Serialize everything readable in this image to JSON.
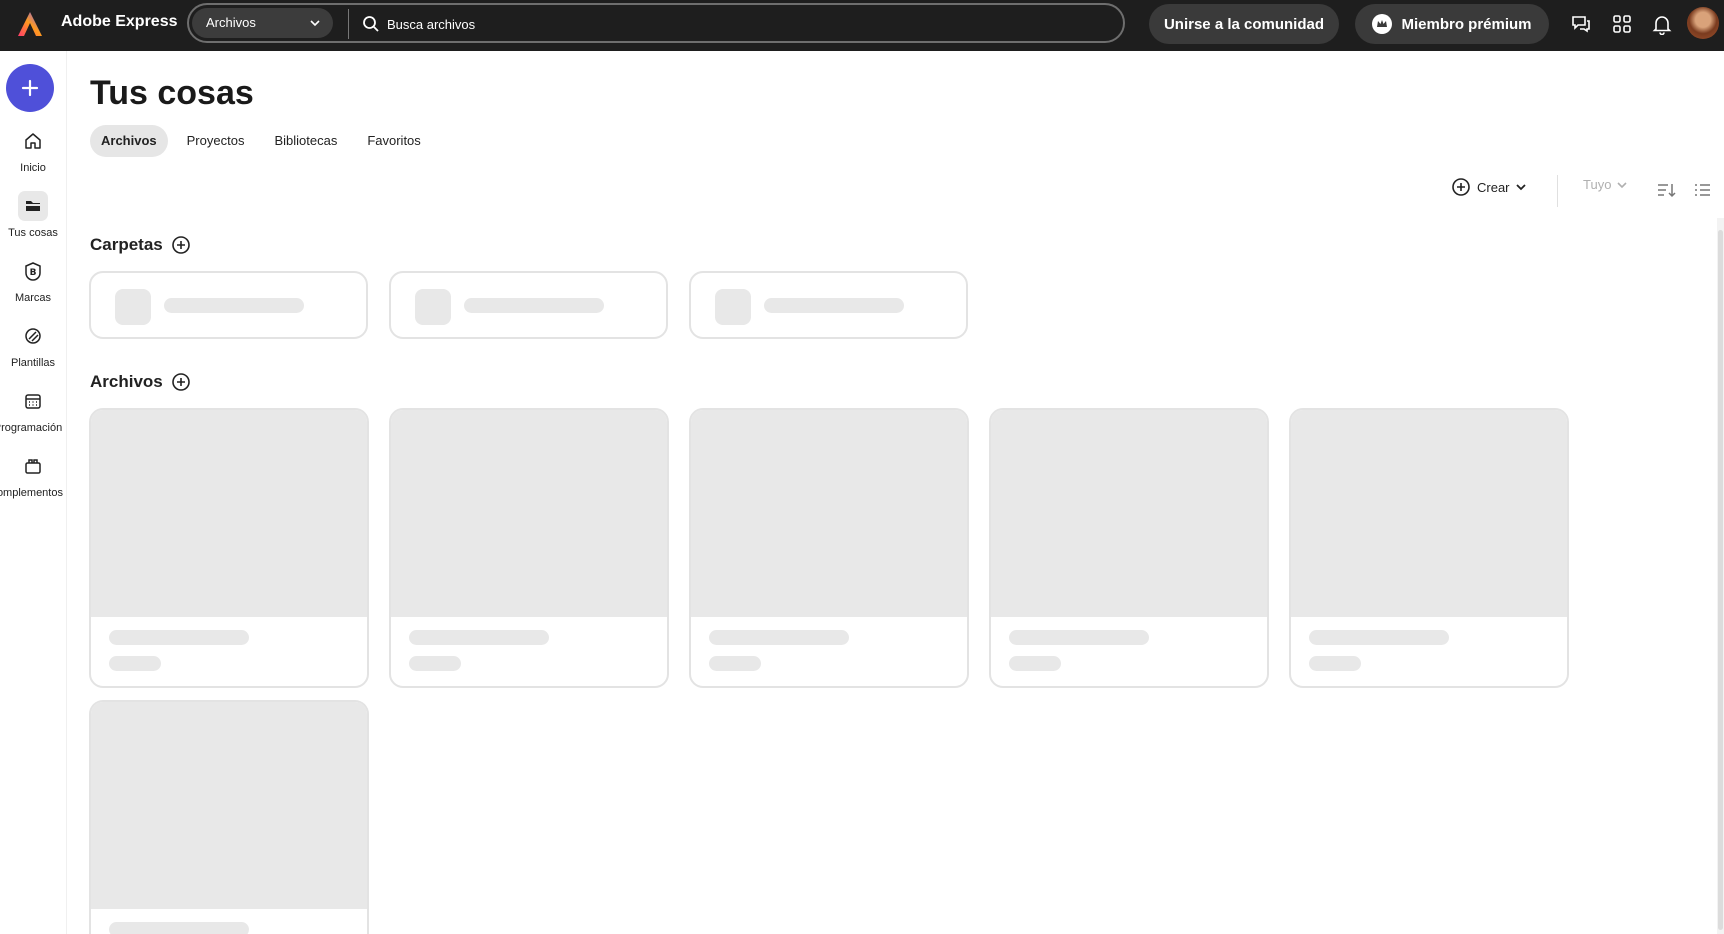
{
  "app": {
    "title": "Adobe Express"
  },
  "search": {
    "scope": "Archivos",
    "placeholder": "Busca archivos"
  },
  "header": {
    "community_label": "Unirse a la comunidad",
    "premium_label": "Miembro prémium"
  },
  "sidebar": {
    "items": [
      {
        "label": "Inicio",
        "icon": "home-icon"
      },
      {
        "label": "Tus cosas",
        "icon": "folder-icon",
        "active": true
      },
      {
        "label": "Marcas",
        "icon": "brand-icon"
      },
      {
        "label": "Plantillas",
        "icon": "templates-icon"
      },
      {
        "label": "Programación",
        "icon": "calendar-icon"
      },
      {
        "label": "Complementos",
        "icon": "addons-icon"
      }
    ]
  },
  "main": {
    "title": "Tus cosas",
    "tabs": [
      {
        "label": "Archivos",
        "active": true
      },
      {
        "label": "Proyectos"
      },
      {
        "label": "Bibliotecas"
      },
      {
        "label": "Favoritos"
      }
    ],
    "toolbar": {
      "create_label": "Crear",
      "owner_filter": "Tuyo"
    },
    "sections": {
      "folders": "Carpetas",
      "files": "Archivos"
    }
  },
  "colors": {
    "topbar": "#1e1e1e",
    "accent": "#4f50d9",
    "skeleton": "#e8e8e8"
  }
}
